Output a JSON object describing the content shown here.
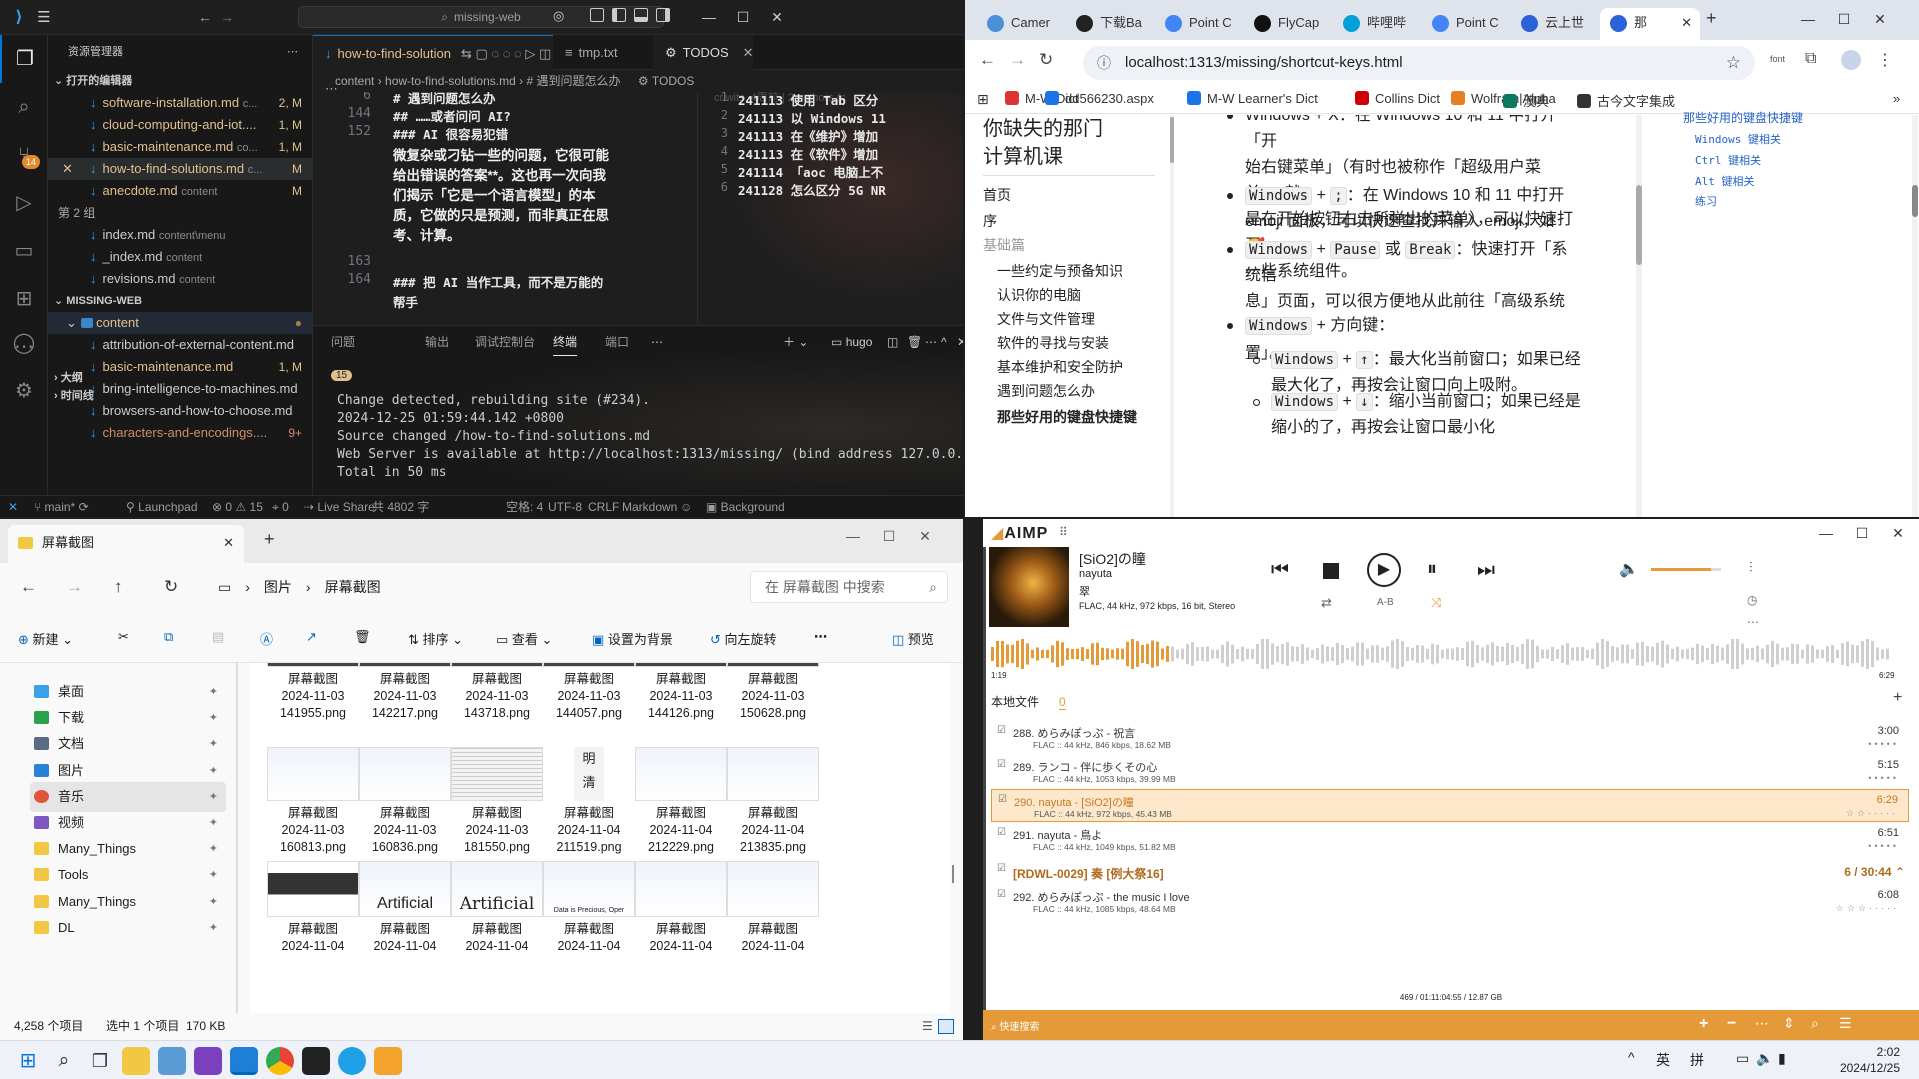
{
  "vscode": {
    "title_search": "missing-web",
    "explorer_title": "资源管理器",
    "open_editors_header": "打开的编辑器",
    "open_editors": [
      {
        "name": "software-installation.md",
        "sub": "c...",
        "status": "2, M"
      },
      {
        "name": "cloud-computing-and-iot....",
        "sub": "",
        "status": "1, M"
      },
      {
        "name": "basic-maintenance.md",
        "sub": "co...",
        "status": "1, M"
      },
      {
        "name": "how-to-find-solutions.md",
        "sub": "c...",
        "status": "M"
      },
      {
        "name": "anecdote.md",
        "sub": "content",
        "status": "M"
      }
    ],
    "group2_label": "第 2 组",
    "group2_files": [
      {
        "name": "index.md",
        "sub": "content\\menu"
      },
      {
        "name": "_index.md",
        "sub": "content"
      },
      {
        "name": "revisions.md",
        "sub": "content"
      }
    ],
    "workspace_header": "MISSING-WEB",
    "content_folder": "content",
    "content_files": [
      {
        "name": "attribution-of-external-content.md",
        "status": ""
      },
      {
        "name": "basic-maintenance.md",
        "status": "1, M"
      },
      {
        "name": "bring-intelligence-to-machines.md",
        "status": ""
      },
      {
        "name": "browsers-and-how-to-choose.md",
        "status": ""
      },
      {
        "name": "characters-and-encodings....",
        "status": "9+"
      }
    ],
    "outline_label": "大纲",
    "timeline_label": "时间线",
    "tabs": {
      "active": "how-to-find-solution",
      "tmp": "tmp.txt",
      "todos": "TODOS"
    },
    "breadcrumb": [
      "content",
      "how-to-find-solutions.md",
      "# 遇到问题怎么办"
    ],
    "breadcrumb2": "TODOS",
    "editor_lines": [
      {
        "n": "6",
        "text": "# 遇到问题怎么办"
      },
      {
        "n": "144",
        "text": "## ……或者问问 AI?"
      },
      {
        "n": "152",
        "text": "### AI 很容易犯错"
      },
      {
        "n": "",
        "text": "微复杂或刁钻一些的问题，它很可能"
      },
      {
        "n": "",
        "text": "给出错误的答案**。这也再一次向我"
      },
      {
        "n": "",
        "text": "们揭示「它是一个语言模型」的本"
      },
      {
        "n": "",
        "text": "质，它做的只是预测，而非真正在思"
      },
      {
        "n": "",
        "text": "考、计算。"
      },
      {
        "n": "163",
        "text": ""
      },
      {
        "n": "164",
        "text": "### 把 AI 当作工具，而不是万能的"
      },
      {
        "n": "",
        "text": "帮手"
      }
    ],
    "blame": "criwits, 4周前 | 2 authors (c",
    "todo_lines": [
      {
        "n": "1",
        "text": "241113 使用 Tab 区分"
      },
      {
        "n": "2",
        "text": "241113 以 Windows 11"
      },
      {
        "n": "3",
        "text": "241113 在《维护》增加"
      },
      {
        "n": "4",
        "text": "241113 在《软件》增加"
      },
      {
        "n": "5",
        "text": "241114 「aoc 电脑上不"
      },
      {
        "n": "6",
        "text": "241128 怎么区分 5G NR"
      }
    ],
    "panel_tabs": [
      "问题",
      "输出",
      "调试控制台",
      "终端",
      "端口"
    ],
    "problems_count": "15",
    "terminal_name": "hugo",
    "terminal_lines": [
      "Change detected, rebuilding site (#234).",
      "2024-12-25 01:59:44.142 +0800",
      "Source changed /how-to-find-solutions.md",
      "Web Server is available at http://localhost:1313/missing/ (bind address 127.0.0.1)",
      "Total in 50 ms"
    ],
    "status": {
      "branch": "main*",
      "launchpad": "Launchpad",
      "errors": "0",
      "warnings": "15",
      "ports": "0",
      "live_share": "Live Share",
      "word_count": "共 4802 字",
      "spaces": "空格: 4",
      "encoding": "UTF-8",
      "eol": "CRLF",
      "language": "Markdown",
      "background": "Background"
    },
    "activity_badge": "14"
  },
  "chrome": {
    "tabs": [
      "Camer",
      "下载Ba",
      "Point C",
      "FlyCap",
      "哔哩哔",
      "Point C",
      "云上世",
      "那"
    ],
    "url": "localhost:1313/missing/shortcut-keys.html",
    "bookmarks": [
      "M-W Dict",
      "dd566230.aspx",
      "M-W Learner's Dict",
      "Collins Dict",
      "Wolfram|Alpha",
      "澳典",
      "古今文字集成"
    ],
    "ext_label": "font",
    "site_title_line1": "你缺失的那门",
    "site_title_line2": "计算机课",
    "nav": [
      "首页",
      "序",
      "基础篇",
      "一些约定与预备知识",
      "认识你的电脑",
      "文件与文件管理",
      "软件的寻找与安装",
      "基本维护和安全防护",
      "遇到问题怎么办",
      "那些好用的键盘快捷键"
    ],
    "toc": [
      "那些好用的键盘快捷键",
      "Windows 键相关",
      "Ctrl 键相关",
      "Alt 键相关",
      "练习"
    ],
    "body": {
      "p0_line1": "Windows + X：在 Windows 10 和 11 中打开「开",
      "p0_line2": "始右键菜单」（有时也被称作「超级用户菜单」，就",
      "p0_line3": "是在开始按钮右击所弹出的菜单），可以快速打开",
      "p0_line4": "一些系统组件。",
      "p1_key1": "Windows",
      "p1_key2": ";",
      "p1_line1": "：在 Windows 10 和 11 中打开",
      "p1_line2": "emoji 面板，可以快速查找并输入 emoji，如🥰。",
      "p2_key1": "Windows",
      "p2_key2": "Pause",
      "p2_or": "或",
      "p2_key3": "Break",
      "p2_line1": "：快速打开「系统信",
      "p2_line2": "息」页面，可以很方便地从此前往「高级系统设",
      "p2_line3": "置」。",
      "p3_key": "Windows",
      "p3_text": "+ 方向键：",
      "s1_key1": "Windows",
      "s1_key2": "↑",
      "s1_line1": "：最大化当前窗口；如果已经",
      "s1_line2": "最大化了，再按会让窗口向上吸附。",
      "s2_key1": "Windows",
      "s2_key2": "↓",
      "s2_line1": "：缩小当前窗口；如果已经是",
      "s2_line2": "缩小的了，再按会让窗口最小化"
    }
  },
  "explorer": {
    "tab_title": "屏幕截图",
    "path": [
      "图片",
      "屏幕截图"
    ],
    "search_placeholder": "在 屏幕截图 中搜索",
    "toolbar": [
      "新建",
      "排序",
      "查看",
      "设置为背景",
      "向左旋转",
      "预览"
    ],
    "sidebar": [
      "桌面",
      "下载",
      "文档",
      "图片",
      "音乐",
      "视频",
      "Many_Things",
      "Tools",
      "Many_Things",
      "DL"
    ],
    "tiles": [
      {
        "name": "屏幕截图",
        "line2": "2024-11-03",
        "line3": "141955.png"
      },
      {
        "name": "屏幕截图",
        "line2": "2024-11-03",
        "line3": "142217.png"
      },
      {
        "name": "屏幕截图",
        "line2": "2024-11-03",
        "line3": "143718.png"
      },
      {
        "name": "屏幕截图",
        "line2": "2024-11-03",
        "line3": "144057.png"
      },
      {
        "name": "屏幕截图",
        "line2": "2024-11-03",
        "line3": "144126.png"
      },
      {
        "name": "屏幕截图",
        "line2": "2024-11-03",
        "line3": "150628.png"
      },
      {
        "name": "屏幕截图",
        "line2": "2024-11-03",
        "line3": "160813.png"
      },
      {
        "name": "屏幕截图",
        "line2": "2024-11-03",
        "line3": "160836.png"
      },
      {
        "name": "屏幕截图",
        "line2": "2024-11-03",
        "line3": "181550.png"
      },
      {
        "name": "屏幕截图",
        "line2": "2024-11-04",
        "line3": "211519.png"
      },
      {
        "name": "屏幕截图",
        "line2": "2024-11-04",
        "line3": "212229.png"
      },
      {
        "name": "屏幕截图",
        "line2": "2024-11-04",
        "line3": "213835.png"
      },
      {
        "name": "屏幕截图",
        "line2": "2024-11-04",
        "line3": ""
      },
      {
        "name": "屏幕截图",
        "line2": "2024-11-04",
        "line3": ""
      },
      {
        "name": "屏幕截图",
        "line2": "2024-11-04",
        "line3": ""
      },
      {
        "name": "屏幕截图",
        "line2": "2024-11-04",
        "line3": ""
      },
      {
        "name": "屏幕截图",
        "line2": "2024-11-04",
        "line3": ""
      },
      {
        "name": "屏幕截图",
        "line2": "2024-11-04",
        "line3": ""
      }
    ],
    "thumb_texts": {
      "t10a": "明",
      "t10b": "清",
      "t14": "Artificial",
      "t15": "Artificial",
      "t16": "Data is Precious, Oper"
    },
    "status_count": "4,258 个项目",
    "status_selected": "选中 1 个项目  170 KB"
  },
  "aimp": {
    "logo": "AIMP",
    "track_title": "[SiO2]の瞳",
    "track_artist": "nayuta",
    "track_album": "翠",
    "track_format": "FLAC, 44 kHz, 972 kbps, 16 bit, Stereo",
    "time_current": "1:19",
    "time_total": "6:29",
    "ab_label": "A-B",
    "volume": 0.85,
    "progress": 0.2,
    "playlist_tab": "本地文件",
    "playlist_count": "0",
    "items": [
      {
        "title": "288. めらみぽっぷ - 祝言",
        "meta": "FLAC :: 44 kHz, 846 kbps, 18.62 MB",
        "dur": "3:00"
      },
      {
        "title": "289. ランコ - 伴に歩くその心",
        "meta": "FLAC :: 44 kHz, 1053 kbps, 39.99 MB",
        "dur": "5:15"
      },
      {
        "title": "290. nayuta - [SiO2]の瞳",
        "meta": "FLAC :: 44 kHz, 972 kbps, 45.43 MB",
        "dur": "6:29"
      },
      {
        "title": "291. nayuta - 鳥よ",
        "meta": "FLAC :: 44 kHz, 1049 kbps, 51.82 MB",
        "dur": "6:51"
      }
    ],
    "group_title": "[RDWL-0029] 奏 [例大祭16]",
    "group_info": "6 / 30:44",
    "item_after": {
      "title": "292. めらみぽっぷ - the music I love",
      "meta": "FLAC :: 44 kHz, 1085 kbps, 48.64 MB",
      "dur": "6:08"
    },
    "summary": "469 / 01:11:04:55 / 12.87 GB",
    "search_label": "快速搜索",
    "accent": "#e49a39"
  },
  "taskbar": {
    "ime1": "英",
    "ime2": "拼",
    "time": "2:02",
    "date": "2024/12/25"
  }
}
